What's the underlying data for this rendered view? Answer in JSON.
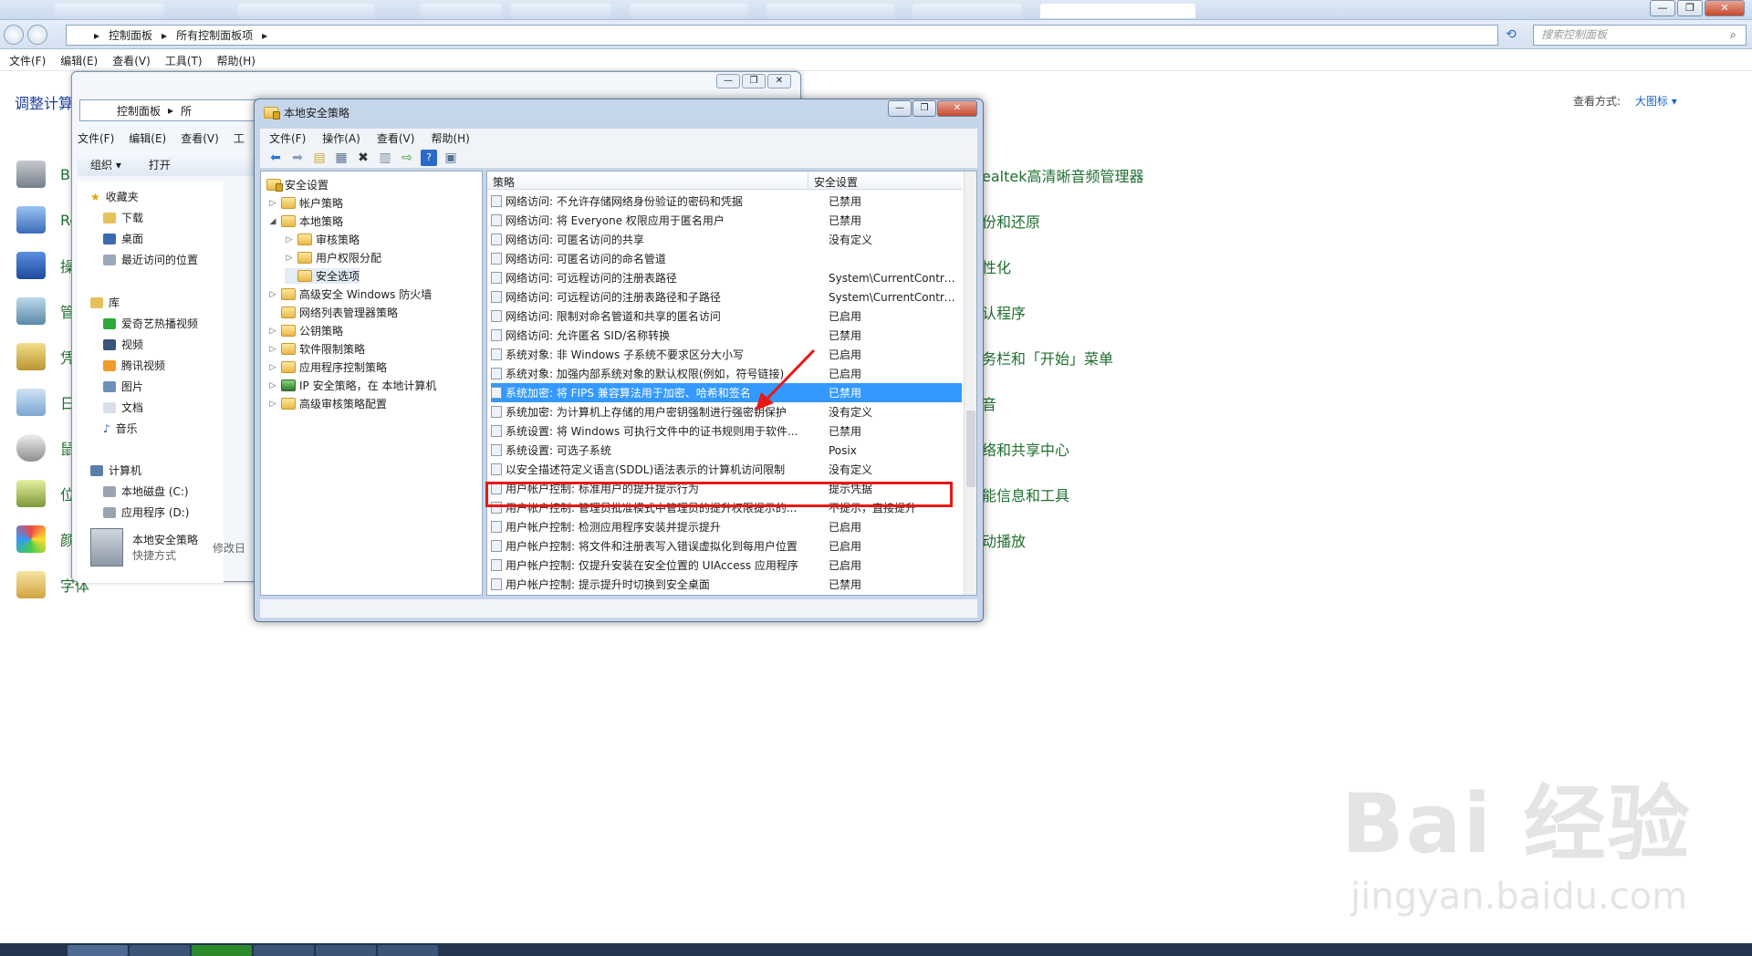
{
  "explorer": {
    "breadcrumb": [
      "控制面板",
      "所有控制面板项"
    ],
    "search_placeholder": "搜索控制面板",
    "menu": [
      "文件(F)",
      "编辑(E)",
      "查看(V)",
      "工具(T)",
      "帮助(H)"
    ],
    "left_title": "调整计算",
    "view_by_label": "查看方式:",
    "view_by_value": "大图标 ▾",
    "left_items": [
      "Bi",
      "Re",
      "操",
      "管",
      "凭",
      "日",
      "鼠",
      "位",
      "颜",
      "字体"
    ],
    "right_items": [
      "ealtek高清晰音频管理器",
      "份和还原",
      "性化",
      "认程序",
      "务栏和「开始」菜单",
      "音",
      "络和共享中心",
      "能信息和工具",
      "动播放"
    ]
  },
  "window2": {
    "breadcrumb": [
      "控制面板",
      "所"
    ],
    "menu": [
      "文件(F)",
      "编辑(E)",
      "查看(V)",
      "工"
    ],
    "toolbar": [
      "组织 ▾",
      "打开"
    ],
    "nav": {
      "favorites": "收藏夹",
      "fav_items": [
        "下载",
        "桌面",
        "最近访问的位置"
      ],
      "library": "库",
      "lib_items": [
        "爱奇艺热播视频",
        "视频",
        "腾讯视频",
        "图片",
        "文档",
        "音乐"
      ],
      "computer": "计算机",
      "comp_items": [
        "本地磁盘 (C:)",
        "应用程序 (D:)"
      ]
    },
    "status_name": "本地安全策略",
    "status_sub": "快捷方式",
    "status_extra": "修改日"
  },
  "dialog": {
    "title": "本地安全策略",
    "menu": [
      "文件(F)",
      "操作(A)",
      "查看(V)",
      "帮助(H)"
    ],
    "tree": {
      "root": "安全设置",
      "items": [
        "帐户策略",
        "本地策略",
        "审核策略",
        "用户权限分配",
        "安全选项",
        "高级安全 Windows 防火墙",
        "网络列表管理器策略",
        "公钥策略",
        "软件限制策略",
        "应用程序控制策略",
        "IP 安全策略，在 本地计算机",
        "高级审核策略配置"
      ]
    },
    "columns": [
      "策略",
      "安全设置"
    ],
    "rows": [
      {
        "policy": "网络访问: 不允许存储网络身份验证的密码和凭据",
        "setting": "已禁用"
      },
      {
        "policy": "网络访问: 将 Everyone 权限应用于匿名用户",
        "setting": "已禁用"
      },
      {
        "policy": "网络访问: 可匿名访问的共享",
        "setting": "没有定义"
      },
      {
        "policy": "网络访问: 可匿名访问的命名管道",
        "setting": ""
      },
      {
        "policy": "网络访问: 可远程访问的注册表路径",
        "setting": "System\\CurrentContro..."
      },
      {
        "policy": "网络访问: 可远程访问的注册表路径和子路径",
        "setting": "System\\CurrentContro..."
      },
      {
        "policy": "网络访问: 限制对命名管道和共享的匿名访问",
        "setting": "已启用"
      },
      {
        "policy": "网络访问: 允许匿名 SID/名称转换",
        "setting": "已禁用"
      },
      {
        "policy": "系统对象: 非 Windows 子系统不要求区分大小写",
        "setting": "已启用"
      },
      {
        "policy": "系统对象: 加强内部系统对象的默认权限(例如，符号链接)",
        "setting": "已启用"
      },
      {
        "policy": "系统加密: 将 FIPS 兼容算法用于加密、哈希和签名",
        "setting": "已禁用",
        "selected": true
      },
      {
        "policy": "系统加密: 为计算机上存储的用户密钥强制进行强密钥保护",
        "setting": "没有定义"
      },
      {
        "policy": "系统设置: 将 Windows 可执行文件中的证书规则用于软件...",
        "setting": "已禁用"
      },
      {
        "policy": "系统设置: 可选子系统",
        "setting": "Posix"
      },
      {
        "policy": "以安全描述符定义语言(SDDL)语法表示的计算机访问限制",
        "setting": "没有定义"
      },
      {
        "policy": "用户帐户控制: 标准用户的提升提示行为",
        "setting": "提示凭据"
      },
      {
        "policy": "用户帐户控制: 管理员批准模式中管理员的提升权限提示的...",
        "setting": "不提示，直接提升"
      },
      {
        "policy": "用户帐户控制: 检测应用程序安装并提示提升",
        "setting": "已启用"
      },
      {
        "policy": "用户帐户控制: 将文件和注册表写入错误虚拟化到每用户位置",
        "setting": "已启用"
      },
      {
        "policy": "用户帐户控制: 仅提升安装在安全位置的 UIAccess 应用程序",
        "setting": "已启用"
      },
      {
        "policy": "用户帐户控制: 提示提升时切换到安全桌面",
        "setting": "已禁用"
      }
    ]
  },
  "watermark": {
    "main": "Bai 经验",
    "sub": "jingyan.baidu.com"
  },
  "colors": {
    "selection": "#3399ff",
    "highlight_box": "#e81818",
    "link_green": "#1e6e2e"
  }
}
